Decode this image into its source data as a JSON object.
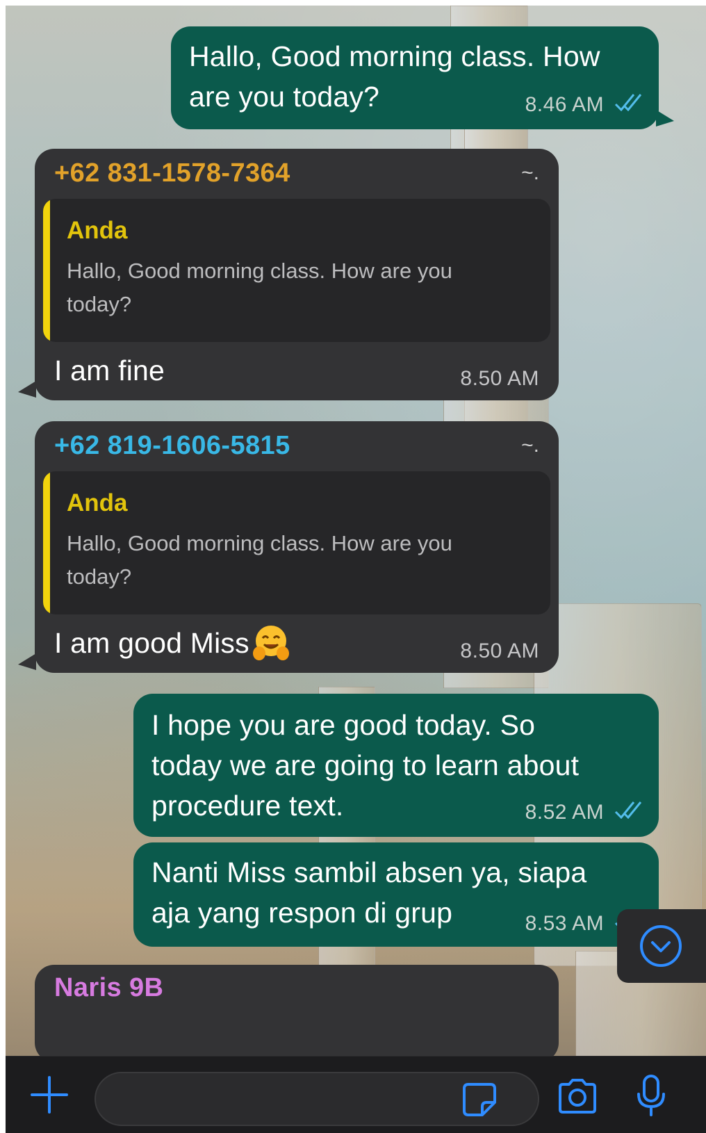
{
  "messages": [
    {
      "direction": "outgoing",
      "text_lines": [
        "Hallo, Good morning class. How",
        "are you today?"
      ],
      "time": "8.46 AM",
      "status": "read"
    },
    {
      "direction": "incoming",
      "sender": "+62 831-1578-7364",
      "sender_color": "#e2a22a",
      "more": "~.",
      "quote_author": "Anda",
      "quote_lines": [
        "Hallo, Good morning class. How are you",
        "today?"
      ],
      "text": "I am fine",
      "time": "8.50 AM"
    },
    {
      "direction": "incoming",
      "sender": "+62 819-1606-5815",
      "sender_color": "#39b8e6",
      "more": "~.",
      "quote_author": "Anda",
      "quote_lines": [
        "Hallo, Good morning class. How are you",
        "today?"
      ],
      "text": "I am good Miss",
      "emoji": "hugging-face",
      "time": "8.50 AM"
    },
    {
      "direction": "outgoing",
      "text_lines": [
        "I hope you are good today. So",
        "today we are going to learn about",
        "procedure text."
      ],
      "time": "8.52 AM",
      "status": "read"
    },
    {
      "direction": "outgoing",
      "text_lines": [
        "Nanti Miss sambil absen ya, siapa",
        "aja yang respon di grup"
      ],
      "time": "8.53 AM",
      "status": "read"
    },
    {
      "direction": "incoming",
      "sender": "Naris 9B",
      "sender_color": "#d77be0"
    }
  ],
  "composer": {
    "input_value": "",
    "icons": {
      "attach": "plus-icon",
      "sticker": "sticker-icon",
      "camera": "camera-icon",
      "voice": "microphone-icon"
    }
  },
  "scroll_down": {
    "icon": "chevron-down-circle-icon"
  },
  "colors": {
    "outgoing_bubble": "#0b5a4c",
    "incoming_bubble": "#333335",
    "quote_bar": "#f2d40d",
    "accent_blue": "#2f8cff",
    "read_ticks": "#53bdeb"
  }
}
